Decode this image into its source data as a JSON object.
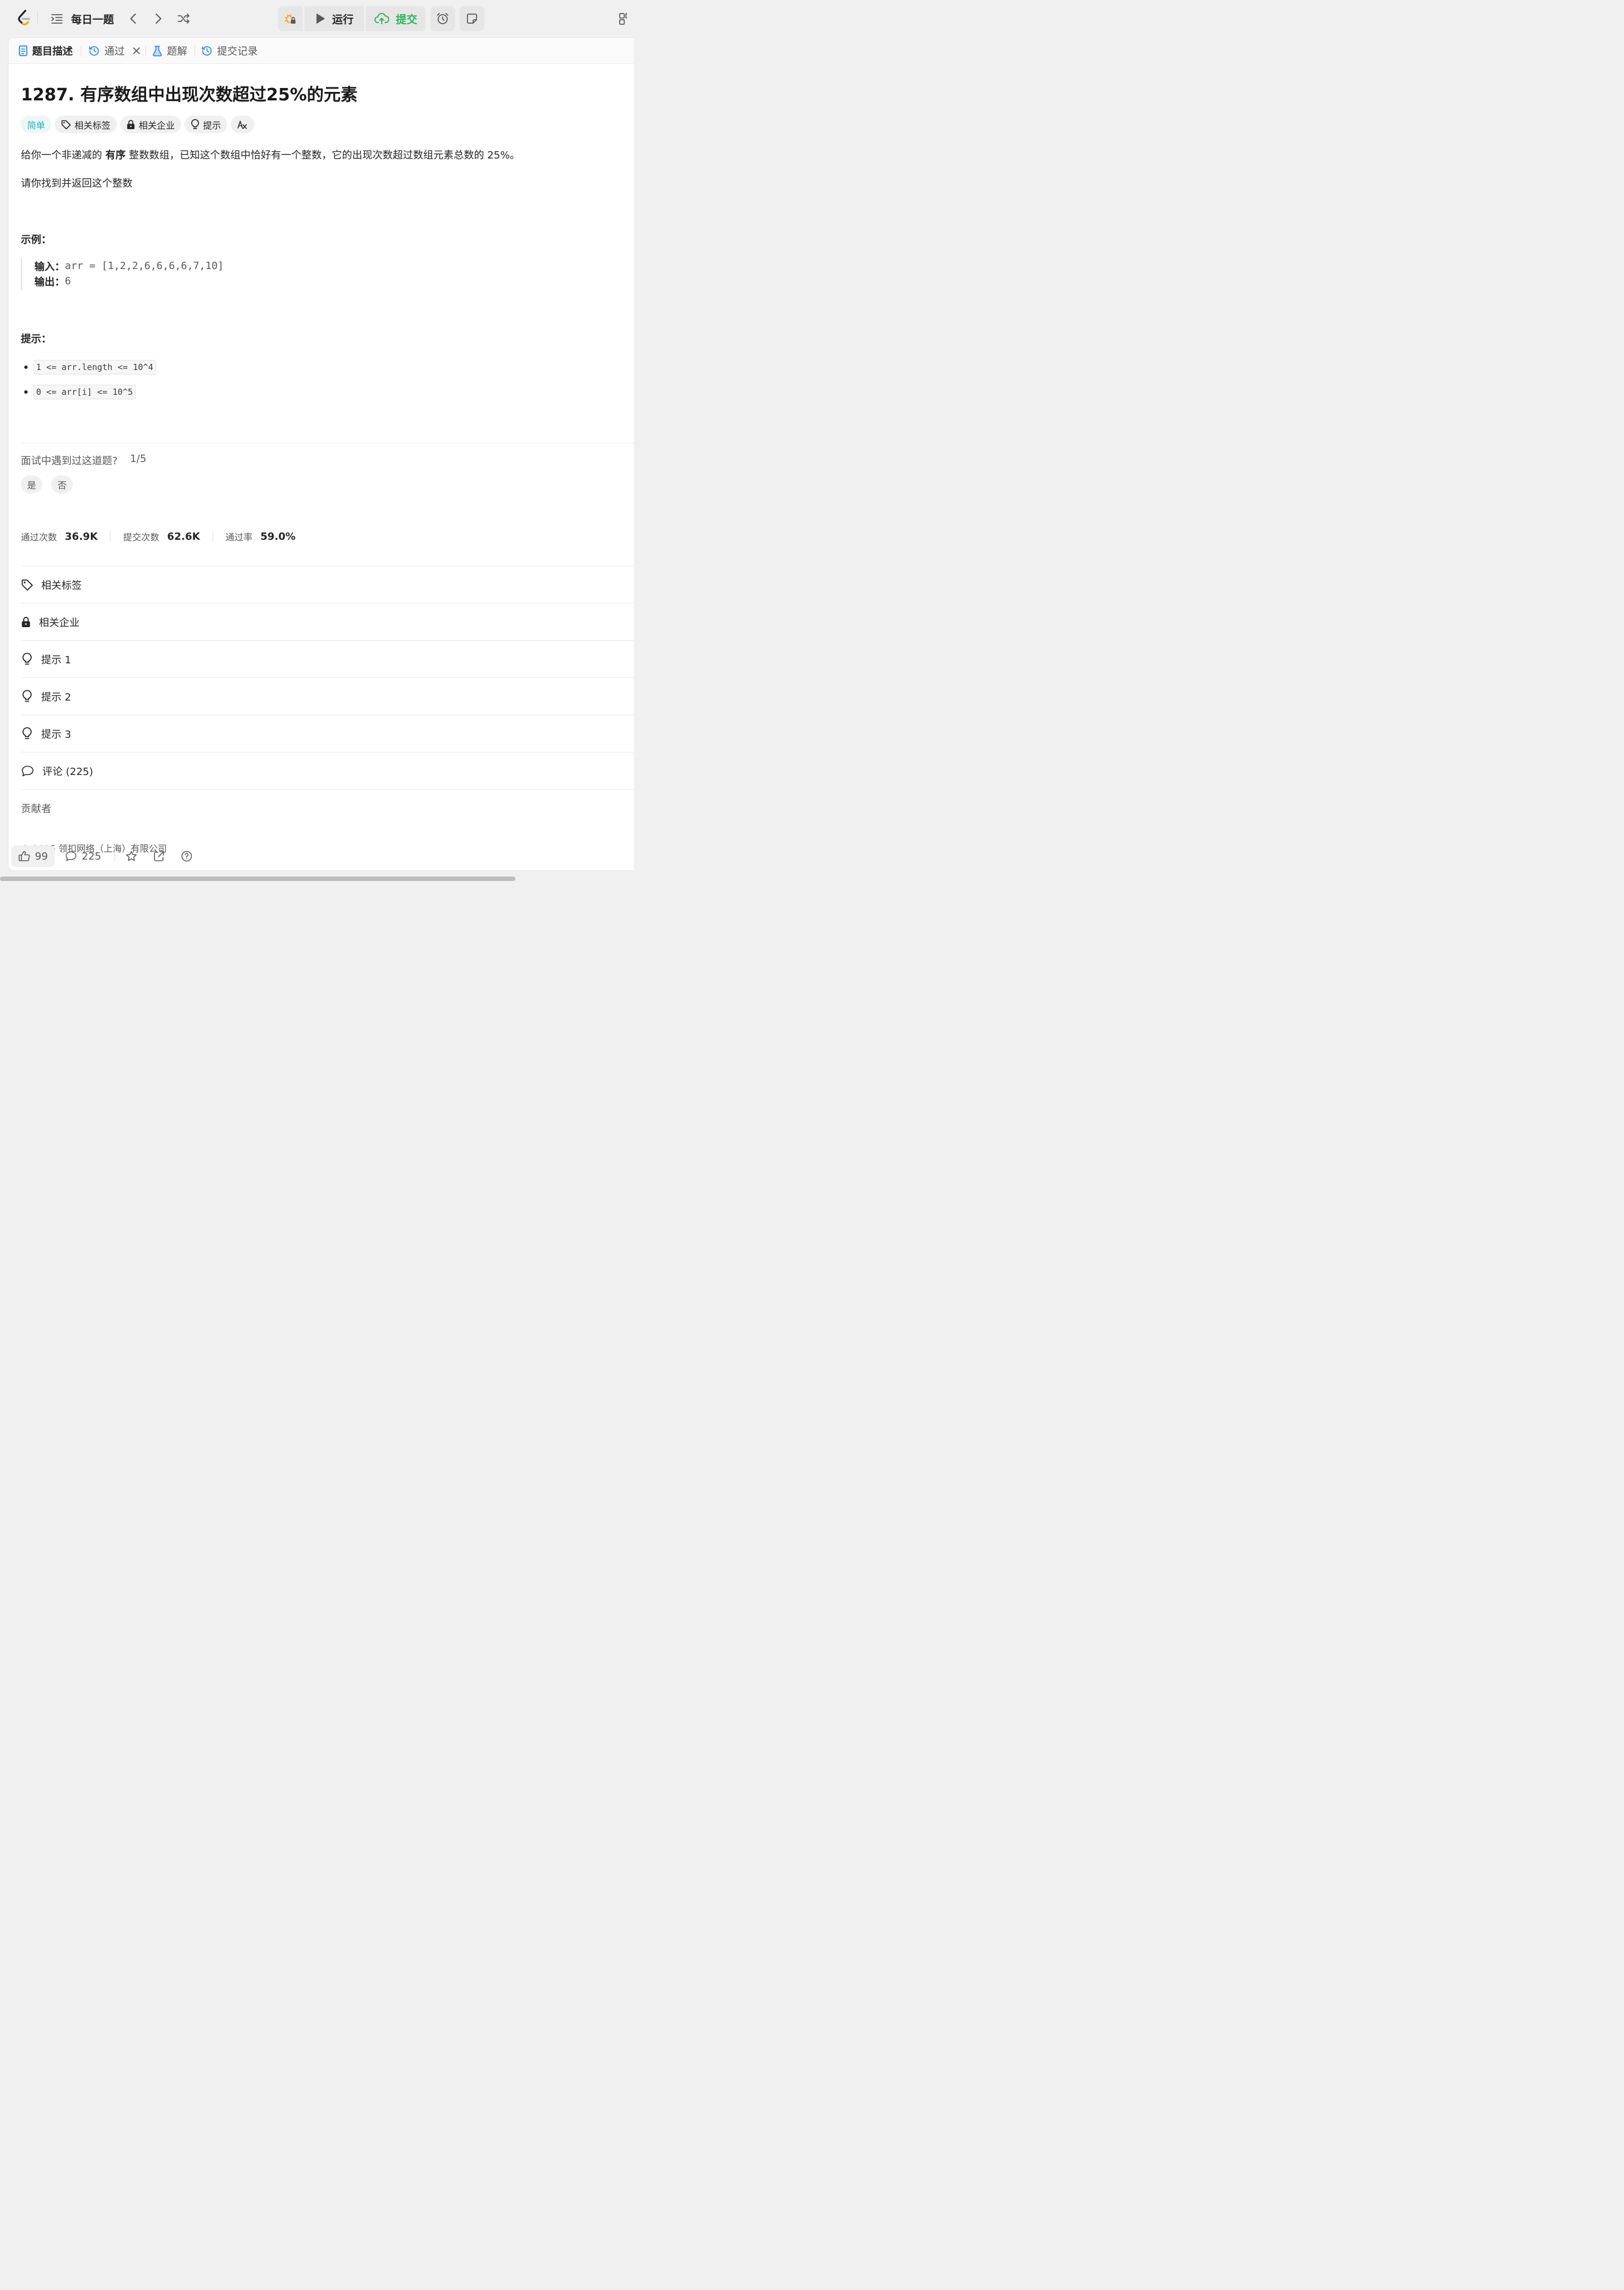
{
  "topbar": {
    "problem_list_label": "每日一题",
    "run_label": "运行",
    "submit_label": "提交"
  },
  "tabs": {
    "description": "题目描述",
    "accepted": "通过",
    "solutions": "题解",
    "submissions": "提交记录"
  },
  "problem": {
    "title": "1287. 有序数组中出现次数超过25%的元素",
    "difficulty": "简单",
    "tag_topics": "相关标签",
    "tag_companies": "相关企业",
    "tag_hint": "提示",
    "desc_1_before": "给你一个非递减的 ",
    "desc_1_bold": "有序",
    "desc_1_after": " 整数数组，已知这个数组中恰好有一个整数，它的出现次数超过数组元素总数的 25%。",
    "desc_2": "请你找到并返回这个整数",
    "example_heading": "示例：",
    "example_input_key": "输入：",
    "example_input_val": "arr = [1,2,2,6,6,6,6,7,10]",
    "example_output_key": "输出：",
    "example_output_val": "6",
    "constraints_heading": "提示：",
    "constraints": [
      "1 <= arr.length <= 10^4",
      "0 <= arr[i] <= 10^5"
    ]
  },
  "interview": {
    "question": "面试中遇到过这道题?",
    "progress": "1/5",
    "yes": "是",
    "no": "否"
  },
  "stats": {
    "accepted_label": "通过次数",
    "accepted_value": "36.9K",
    "submissions_label": "提交次数",
    "submissions_value": "62.6K",
    "rate_label": "通过率",
    "rate_value": "59.0%"
  },
  "sections": {
    "topics": "相关标签",
    "companies": "相关企业",
    "hint1": "提示 1",
    "hint2": "提示 2",
    "hint3": "提示 3",
    "comments": "评论 (225)",
    "contributors": "贡献者"
  },
  "copyright": "© 2025 领扣网络（上海）有限公司",
  "footer": {
    "likes": "99",
    "comments": "225"
  },
  "colors": {
    "accent_green": "#2db55d",
    "easy_teal": "#1cb8b8",
    "orange": "#ffa116"
  },
  "icons": [
    "leetcode-logo-icon",
    "list-icon",
    "chevron-left-icon",
    "chevron-right-icon",
    "shuffle-icon",
    "debug-icon",
    "play-icon",
    "cloud-upload-icon",
    "alarm-icon",
    "note-icon",
    "layout-icon",
    "document-icon",
    "history-icon",
    "flask-icon",
    "close-icon",
    "tag-icon",
    "lock-icon",
    "lightbulb-icon",
    "translate-icon",
    "comment-icon",
    "thumb-up-icon",
    "star-icon",
    "share-icon",
    "help-icon"
  ]
}
